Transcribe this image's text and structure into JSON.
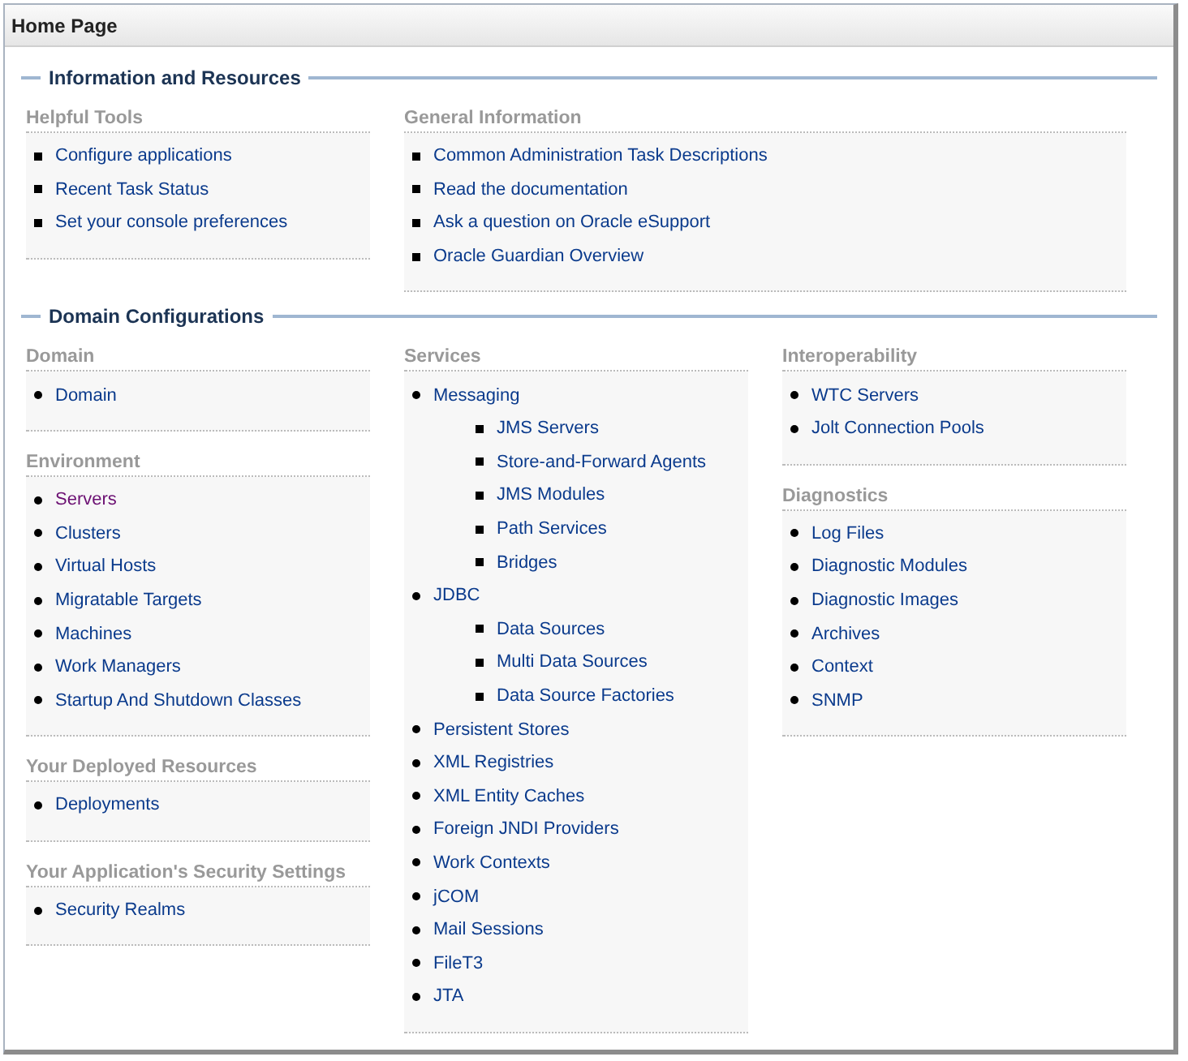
{
  "page": {
    "title": "Home Page"
  },
  "sections": [
    {
      "title": "Information and Resources",
      "columns": [
        [
          {
            "heading": "Helpful Tools",
            "kind": "square",
            "links": [
              {
                "label": "Configure applications",
                "visited": false
              },
              {
                "label": "Recent Task Status",
                "visited": false
              },
              {
                "label": "Set your console preferences",
                "visited": false
              }
            ]
          }
        ],
        [
          {
            "heading": "General Information",
            "kind": "square",
            "links": [
              {
                "label": "Common Administration Task Descriptions",
                "visited": false
              },
              {
                "label": "Read the documentation",
                "visited": false
              },
              {
                "label": "Ask a question on Oracle eSupport",
                "visited": false
              },
              {
                "label": "Oracle Guardian Overview",
                "visited": false
              }
            ]
          }
        ]
      ]
    },
    {
      "title": "Domain Configurations",
      "columns": [
        [
          {
            "heading": "Domain",
            "kind": "round",
            "links": [
              {
                "label": "Domain",
                "visited": false
              }
            ]
          },
          {
            "heading": "Environment",
            "kind": "round",
            "links": [
              {
                "label": "Servers",
                "visited": true
              },
              {
                "label": "Clusters",
                "visited": false
              },
              {
                "label": "Virtual Hosts",
                "visited": false
              },
              {
                "label": "Migratable Targets",
                "visited": false
              },
              {
                "label": "Machines",
                "visited": false
              },
              {
                "label": "Work Managers",
                "visited": false
              },
              {
                "label": "Startup And Shutdown Classes",
                "visited": false
              }
            ]
          },
          {
            "heading": "Your Deployed Resources",
            "kind": "round",
            "links": [
              {
                "label": "Deployments",
                "visited": false
              }
            ]
          },
          {
            "heading": "Your Application's Security Settings",
            "kind": "round",
            "links": [
              {
                "label": "Security Realms",
                "visited": false
              }
            ]
          }
        ],
        [
          {
            "heading": "Services",
            "kind": "round",
            "links": [
              {
                "label": "Messaging",
                "visited": false,
                "children": [
                  {
                    "label": "JMS Servers",
                    "visited": false
                  },
                  {
                    "label": "Store-and-Forward Agents",
                    "visited": false
                  },
                  {
                    "label": "JMS Modules",
                    "visited": false
                  },
                  {
                    "label": "Path Services",
                    "visited": false
                  },
                  {
                    "label": "Bridges",
                    "visited": false
                  }
                ]
              },
              {
                "label": "JDBC",
                "visited": false,
                "children": [
                  {
                    "label": "Data Sources",
                    "visited": false
                  },
                  {
                    "label": "Multi Data Sources",
                    "visited": false
                  },
                  {
                    "label": "Data Source Factories",
                    "visited": false
                  }
                ]
              },
              {
                "label": "Persistent Stores",
                "visited": false
              },
              {
                "label": "XML Registries",
                "visited": false
              },
              {
                "label": "XML Entity Caches",
                "visited": false
              },
              {
                "label": "Foreign JNDI Providers",
                "visited": false
              },
              {
                "label": "Work Contexts",
                "visited": false
              },
              {
                "label": "jCOM",
                "visited": false
              },
              {
                "label": "Mail Sessions",
                "visited": false
              },
              {
                "label": "FileT3",
                "visited": false
              },
              {
                "label": "JTA",
                "visited": false
              }
            ]
          }
        ],
        [
          {
            "heading": "Interoperability",
            "kind": "round",
            "links": [
              {
                "label": "WTC Servers",
                "visited": false
              },
              {
                "label": "Jolt Connection Pools",
                "visited": false
              }
            ]
          },
          {
            "heading": "Diagnostics",
            "kind": "round",
            "links": [
              {
                "label": "Log Files",
                "visited": false
              },
              {
                "label": "Diagnostic Modules",
                "visited": false
              },
              {
                "label": "Diagnostic Images",
                "visited": false
              },
              {
                "label": "Archives",
                "visited": false
              },
              {
                "label": "Context",
                "visited": false
              },
              {
                "label": "SNMP",
                "visited": false
              }
            ]
          }
        ]
      ]
    }
  ]
}
